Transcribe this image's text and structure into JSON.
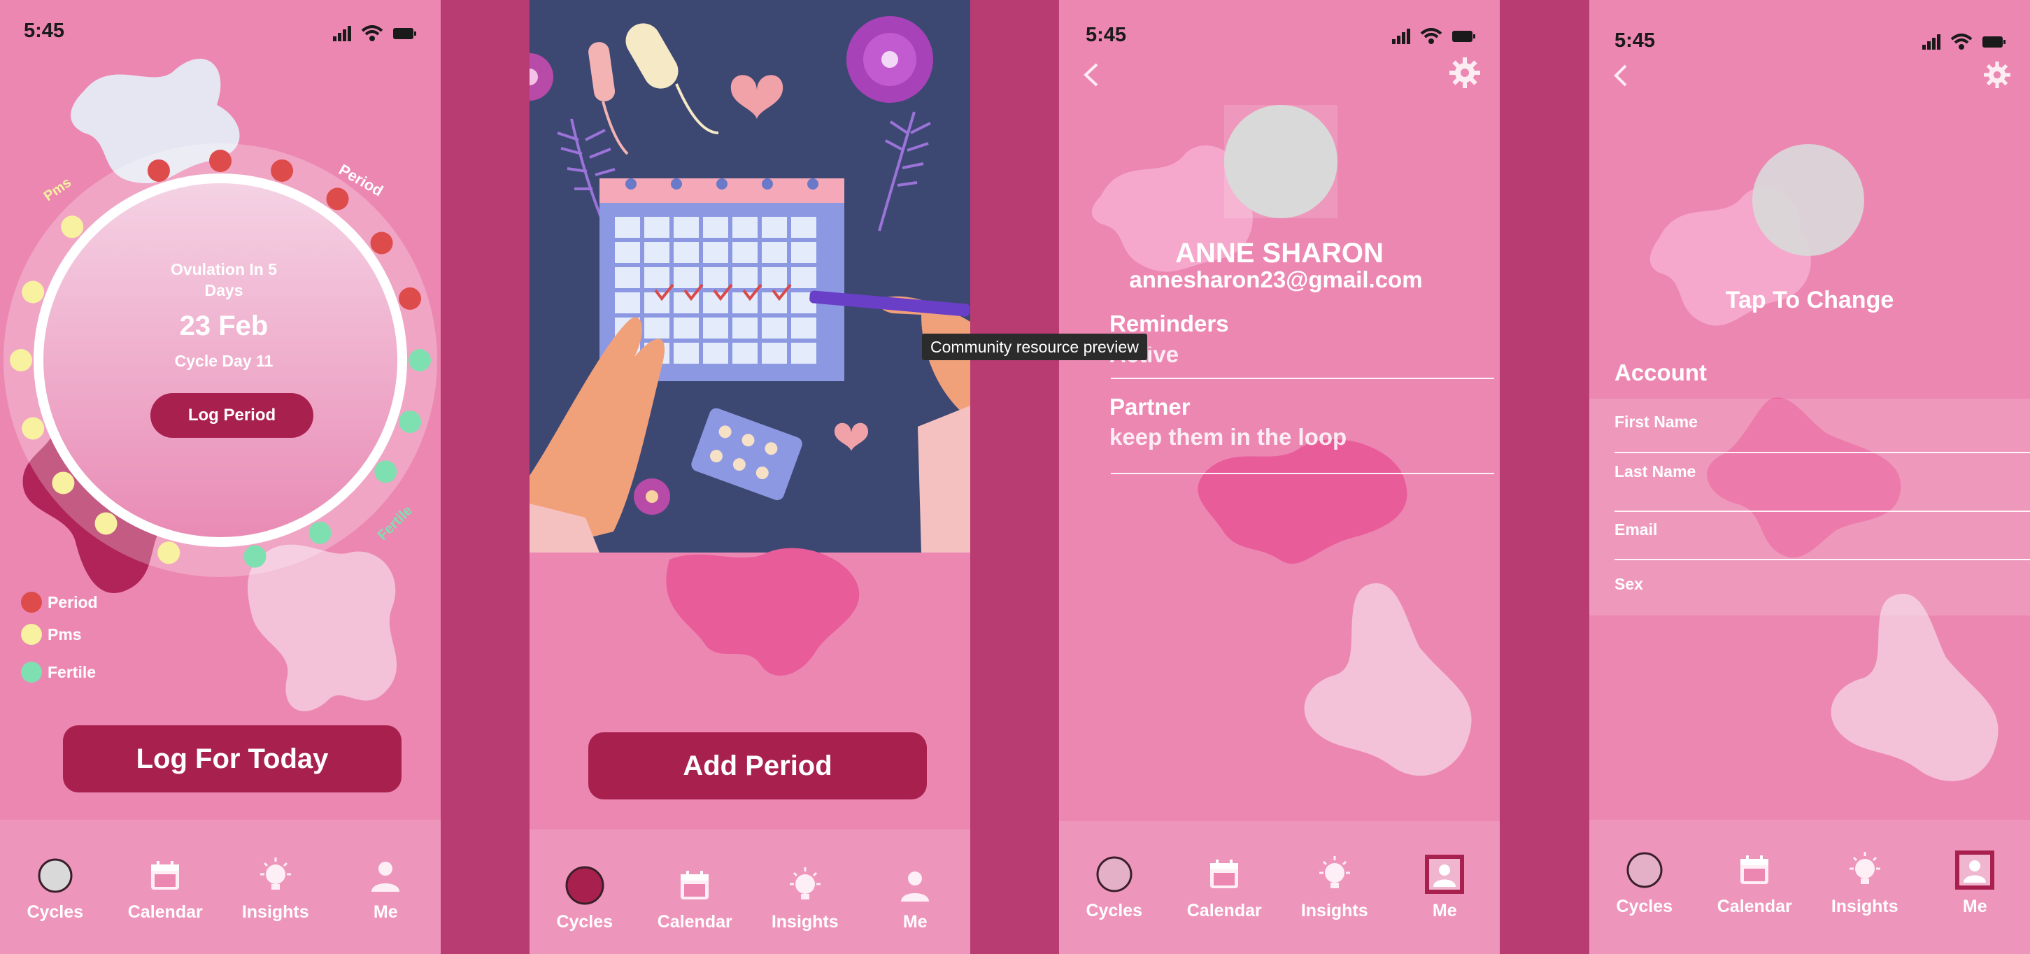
{
  "colors": {
    "background": "#b83c72",
    "screen": "#ec87b2",
    "accent": "#a8204e",
    "period": "#de4b4b",
    "pms": "#f7f1a0",
    "fertile": "#7ee0b0",
    "avatar": "#d9d9d9"
  },
  "status_bar": {
    "time": "5:45"
  },
  "tab_bar": {
    "tabs": [
      {
        "label": "Cycles",
        "icon": "circle-icon"
      },
      {
        "label": "Calendar",
        "icon": "calendar-icon"
      },
      {
        "label": "Insights",
        "icon": "lightbulb-icon"
      },
      {
        "label": "Me",
        "icon": "person-icon"
      }
    ]
  },
  "cycles_screen": {
    "ring_labels": {
      "period": "Period",
      "pms": "Pms",
      "fertile": "Fertile"
    },
    "ovulation_text": "Ovulation In 5 Days",
    "date": "23 Feb",
    "cycle_day": "Cycle Day 11",
    "log_period_label": "Log Period",
    "legend": [
      {
        "label": "Period",
        "color": "#de4b4b"
      },
      {
        "label": "Pms",
        "color": "#f7f1a0"
      },
      {
        "label": "Fertile",
        "color": "#7ee0b0"
      }
    ],
    "log_today_label": "Log For Today"
  },
  "calendar_screen": {
    "add_period_label": "Add Period",
    "tooltip": "Community resource preview"
  },
  "profile_screen": {
    "name": "ANNE SHARON",
    "email": "annesharon23@gmail.com",
    "reminders_title": "Reminders",
    "reminders_sub": "Active",
    "partner_title": "Partner",
    "partner_sub": "keep them in the loop"
  },
  "edit_profile_screen": {
    "tap_to_change": "Tap To Change",
    "account_title": "Account",
    "fields": [
      {
        "label": "First Name",
        "value": ""
      },
      {
        "label": "Last Name",
        "value": ""
      },
      {
        "label": "Email",
        "value": ""
      },
      {
        "label": "Sex",
        "value": ""
      }
    ]
  }
}
